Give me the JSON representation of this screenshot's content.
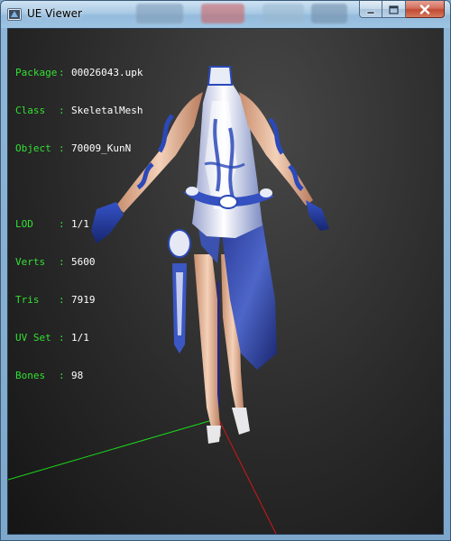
{
  "window": {
    "title": "UE Viewer"
  },
  "mesh_info": {
    "package": {
      "label": "Package",
      "value": "00026043.upk"
    },
    "class": {
      "label": "Class",
      "value": "SkeletalMesh"
    },
    "object": {
      "label": "Object",
      "value": "70009_KunN"
    },
    "lod": {
      "label": "LOD",
      "value": "1/1"
    },
    "verts": {
      "label": "Verts",
      "value": "5600"
    },
    "tris": {
      "label": "Tris",
      "value": "7919"
    },
    "uv_set": {
      "label": "UV Set",
      "value": "1/1"
    },
    "bones": {
      "label": "Bones",
      "value": "98"
    }
  },
  "icons": {
    "app": "ue-viewer-app-icon",
    "minimize": "minimize-icon",
    "maximize": "maximize-icon",
    "close": "close-icon"
  },
  "colors": {
    "info_label": "#33e033",
    "info_value": "#ffffff",
    "axis_x": "#d01818",
    "axis_y": "#1bd81b",
    "axis_z": "#1a1adc",
    "viewport_bg": "#2a2a2a"
  }
}
